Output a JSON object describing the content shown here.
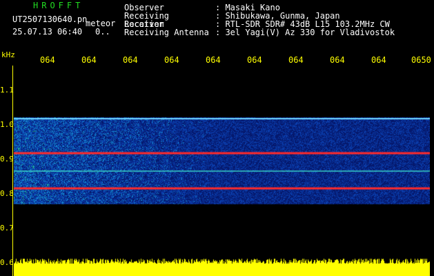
{
  "header": {
    "brand": "HROFFT",
    "filename": "UT2507130640.pn",
    "mode": "meteor",
    "datetime": "25.07.13 06:40",
    "extra": "0.."
  },
  "info": [
    {
      "label": "Observer",
      "value": ": Masaki Kano"
    },
    {
      "label": "Receiving Location",
      "value": ": Shibukawa, Gunma, Japan"
    },
    {
      "label": "Receiver",
      "value": ": RTL-SDR SDR# 43dB L15 103.2MHz CW"
    },
    {
      "label": "Receiving Antenna",
      "value": ": 3el Yagi(V) Az 330 for Vladivostok"
    }
  ],
  "axis": {
    "unit": "kHz",
    "time_labels": [
      "064",
      "064",
      "064",
      "064",
      "064",
      "064",
      "064",
      "064",
      "064",
      "0650"
    ],
    "freq_labels": [
      "1.1",
      "1.0",
      "0.9",
      "0.8",
      "0.7",
      "0.6"
    ]
  },
  "colors": {
    "accent_yellow": "#ffff00",
    "title_green": "#22dd22",
    "red_line": "#ff2a2a",
    "blue_bg": "#0a1f8c"
  }
}
